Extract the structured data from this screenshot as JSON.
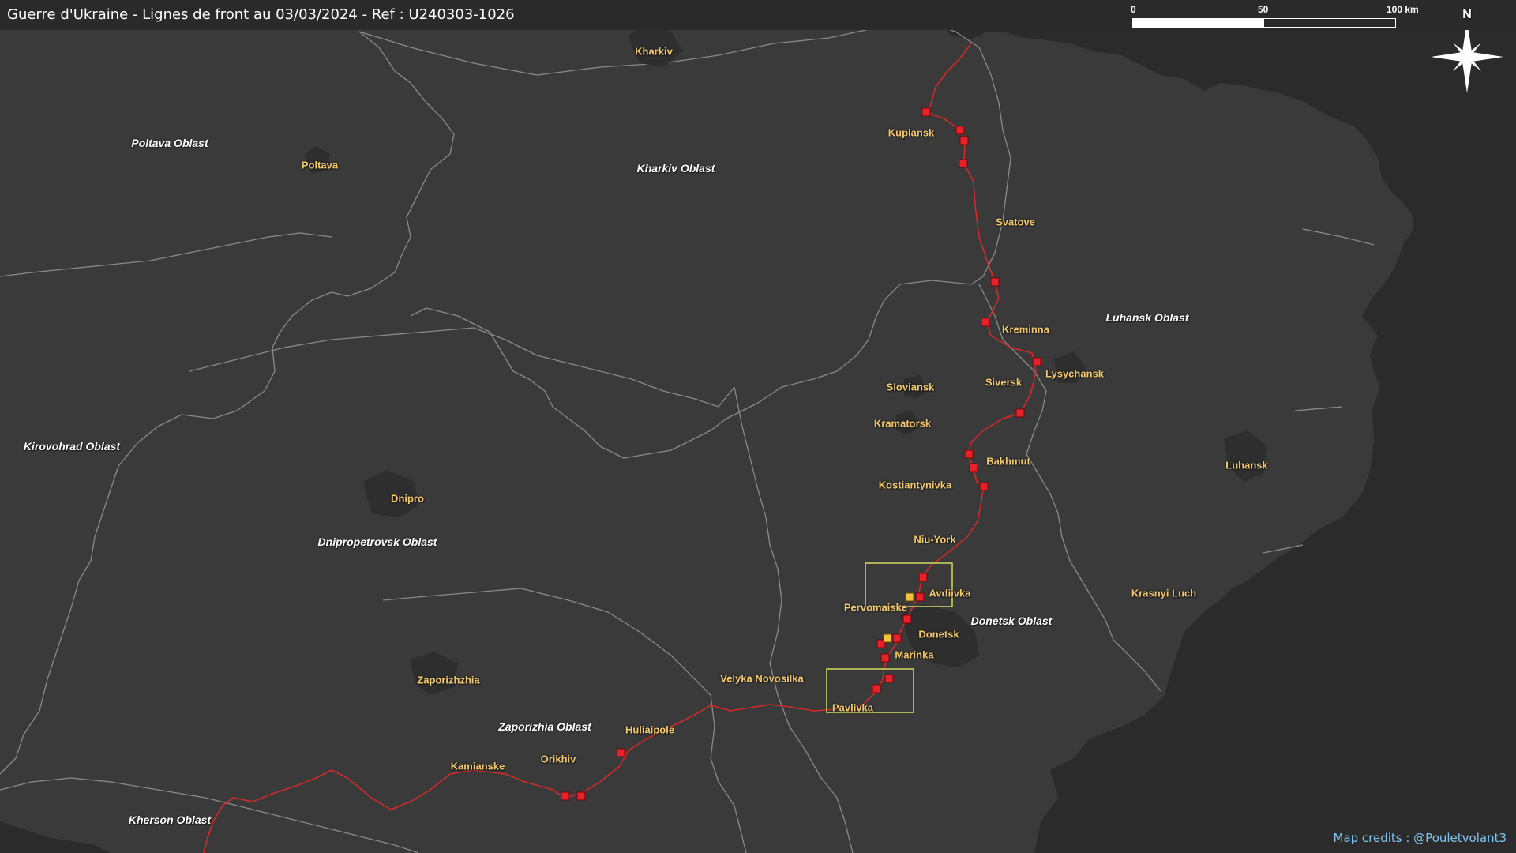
{
  "map": {
    "title": "Guerre d'Ukraine - Lignes de front au 03/03/2024 - Ref : U240303-1026",
    "credits": "Map credits : @Pouletvolant3",
    "north_label": "N",
    "scale": {
      "labels": [
        "0",
        "50",
        "100 km"
      ]
    },
    "colors": {
      "land": "#3a3a3a",
      "outside": "#2b2b2b",
      "borders": "#8a8a8a",
      "urban": "#2e2e2e",
      "front_line": "#d42a2a",
      "markers": "#e8202a",
      "markers_yellow": "#f5c33a",
      "boxes": "#c6d25a",
      "city_text": "#f3c96b",
      "credits": "#7fc6f2"
    },
    "oblasts": [
      {
        "name": "Poltava Oblast"
      },
      {
        "name": "Kharkiv Oblast"
      },
      {
        "name": "Luhansk Oblast"
      },
      {
        "name": "Kirovohrad Oblast"
      },
      {
        "name": "Dnipropetrovsk Oblast"
      },
      {
        "name": "Donetsk Oblast"
      },
      {
        "name": "Zaporizhia Oblast"
      },
      {
        "name": "Kherson Oblast"
      }
    ],
    "cities": [
      {
        "name": "Kharkiv"
      },
      {
        "name": "Poltava"
      },
      {
        "name": "Kupiansk"
      },
      {
        "name": "Svatove"
      },
      {
        "name": "Kreminna"
      },
      {
        "name": "Lysychansk"
      },
      {
        "name": "Siversk"
      },
      {
        "name": "Sloviansk"
      },
      {
        "name": "Kramatorsk"
      },
      {
        "name": "Bakhmut"
      },
      {
        "name": "Kostiantynivka"
      },
      {
        "name": "Luhansk"
      },
      {
        "name": "Dnipro"
      },
      {
        "name": "Niu-York"
      },
      {
        "name": "Avdiivka"
      },
      {
        "name": "Pervomaiske"
      },
      {
        "name": "Donetsk"
      },
      {
        "name": "Marinka"
      },
      {
        "name": "Krasnyi Luch"
      },
      {
        "name": "Zaporizhzhia"
      },
      {
        "name": "Velyka Novosilka"
      },
      {
        "name": "Pavlivka"
      },
      {
        "name": "Huliaipole"
      },
      {
        "name": "Orikhiv"
      },
      {
        "name": "Kamianske"
      }
    ],
    "icons": {
      "compass": "compass-rose-icon",
      "marker": "square-marker-icon"
    }
  }
}
